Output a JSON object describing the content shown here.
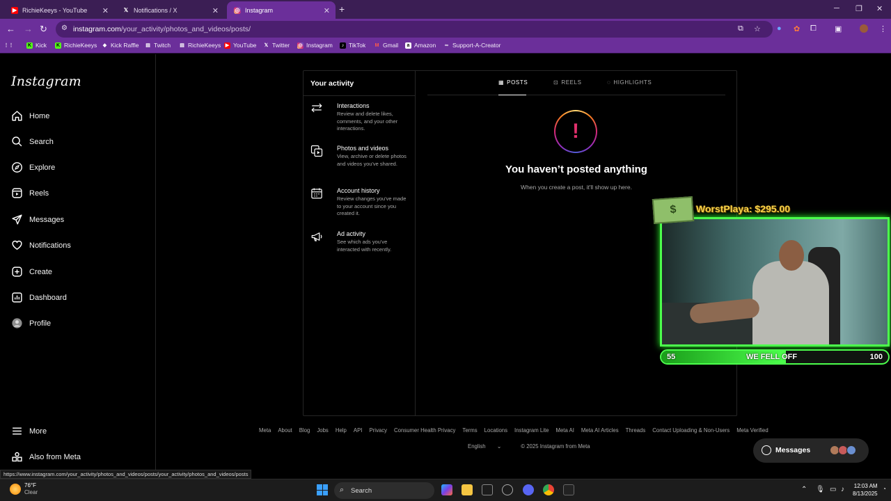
{
  "browser": {
    "tabs": [
      {
        "label": "RichieKeeys - YouTube",
        "icon": "youtube-icon"
      },
      {
        "label": "Notifications / X",
        "icon": "x-icon"
      },
      {
        "label": "Instagram",
        "icon": "instagram-icon",
        "active": true
      }
    ],
    "url_host": "instagram.com",
    "url_path": "/your_activity/photos_and_videos/posts/",
    "bookmarks": [
      "Kick",
      "RichieKeeys",
      "Kick Raffle",
      "Twitch",
      "RichieKeeys",
      "YouTube",
      "Twitter",
      "Instagram",
      "TikTok",
      "Gmail",
      "Amazon",
      "Support-A-Creator"
    ],
    "status_url": "https://www.instagram.com/your_activity/photos_and_videos/posts/your_activity/photos_and_videos/posts"
  },
  "sidebar": {
    "logo": "Instagram",
    "items": [
      {
        "label": "Home",
        "icon": "home-icon"
      },
      {
        "label": "Search",
        "icon": "search-icon"
      },
      {
        "label": "Explore",
        "icon": "compass-icon"
      },
      {
        "label": "Reels",
        "icon": "reels-icon"
      },
      {
        "label": "Messages",
        "icon": "send-icon"
      },
      {
        "label": "Notifications",
        "icon": "heart-icon"
      },
      {
        "label": "Create",
        "icon": "plus-square-icon"
      },
      {
        "label": "Dashboard",
        "icon": "chart-icon"
      },
      {
        "label": "Profile",
        "icon": "avatar-icon"
      }
    ],
    "bottom": [
      {
        "label": "More",
        "icon": "menu-icon"
      },
      {
        "label": "Also from Meta",
        "icon": "meta-apps-icon"
      }
    ]
  },
  "activity": {
    "title": "Your activity",
    "items": [
      {
        "title": "Interactions",
        "desc": "Review and delete likes, comments, and your other interactions.",
        "icon": "arrows-icon"
      },
      {
        "title": "Photos and videos",
        "desc": "View, archive or delete photos and videos you've shared.",
        "icon": "photos-icon"
      },
      {
        "title": "Account history",
        "desc": "Review changes you've made to your account since you created it.",
        "icon": "calendar-icon"
      },
      {
        "title": "Ad activity",
        "desc": "See which ads you've interacted with recently.",
        "icon": "megaphone-icon"
      }
    ]
  },
  "content": {
    "tabs": [
      "POSTS",
      "REELS",
      "HIGHLIGHTS"
    ],
    "selected_tab": "POSTS",
    "empty_title": "You haven’t posted anything",
    "empty_subtitle": "When you create a post, it'll show up here."
  },
  "footer": {
    "links": [
      "Meta",
      "About",
      "Blog",
      "Jobs",
      "Help",
      "API",
      "Privacy",
      "Consumer Health Privacy",
      "Terms",
      "Locations",
      "Instagram Lite",
      "Meta AI",
      "Meta AI Articles",
      "Threads",
      "Contact Uploading & Non-Users",
      "Meta Verified"
    ],
    "language": "English",
    "copyright": "© 2025 Instagram from Meta"
  },
  "messages_pill": {
    "label": "Messages"
  },
  "overlay": {
    "donation": "WorstPlaya: $295.00",
    "goal_current": "55",
    "goal_text": "WE FELL OFF",
    "goal_target": "100",
    "goal_fraction": 0.55
  },
  "taskbar": {
    "temperature": "76°F",
    "condition": "Clear",
    "search_label": "Search",
    "time": "12:03 AM",
    "date": "8/13/2025"
  }
}
